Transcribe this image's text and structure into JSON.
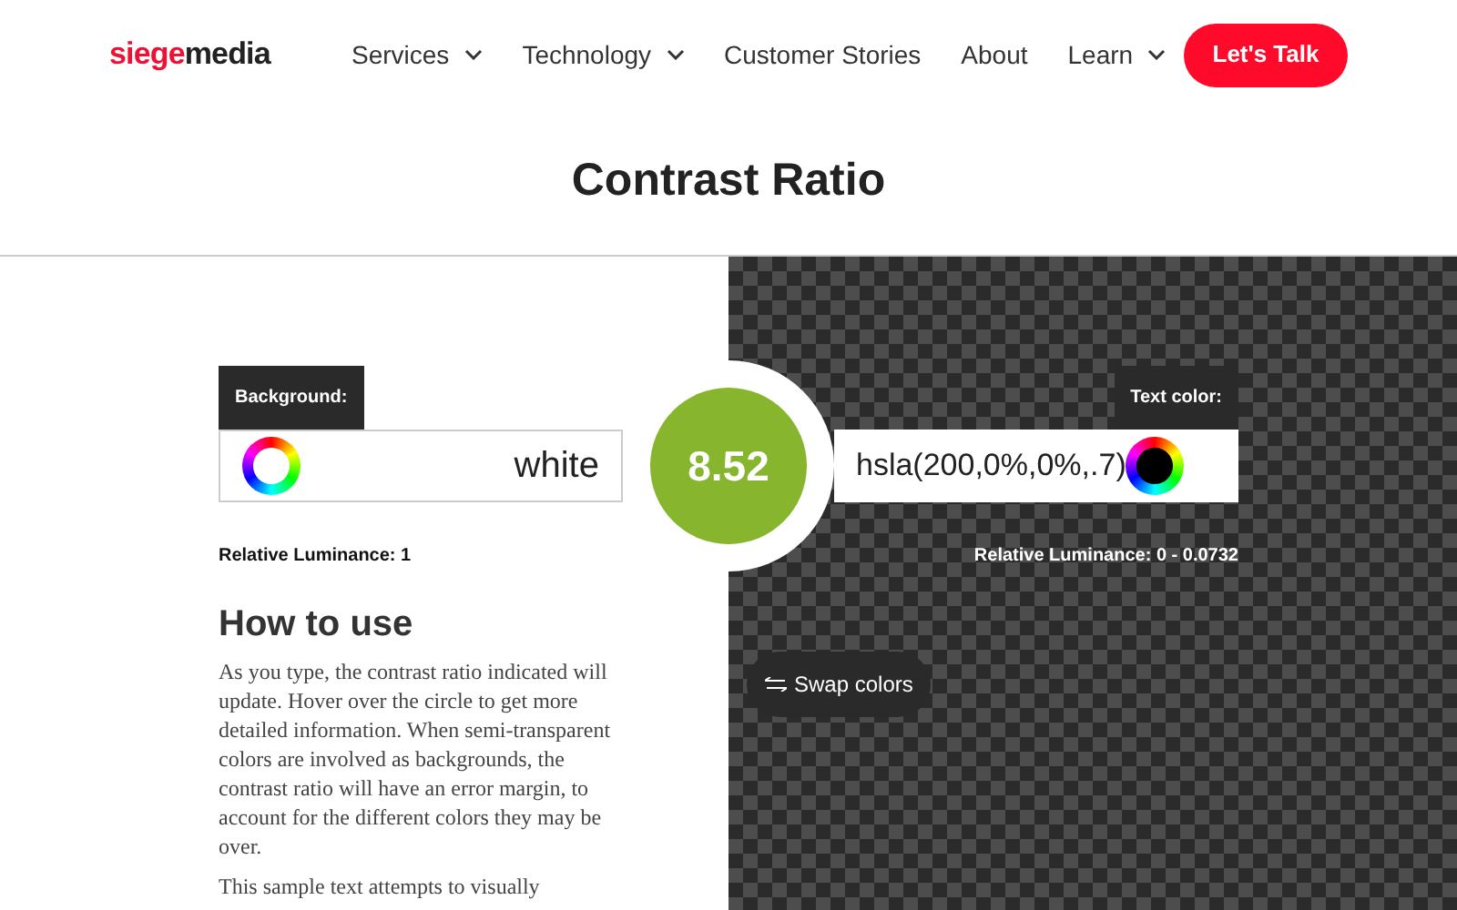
{
  "logo": {
    "part_1": "siege",
    "part_2": "media"
  },
  "nav": [
    {
      "label": "Services",
      "dropdown": true
    },
    {
      "label": "Technology",
      "dropdown": true
    },
    {
      "label": "Customer Stories",
      "dropdown": false
    },
    {
      "label": "About",
      "dropdown": false
    },
    {
      "label": "Learn",
      "dropdown": true
    }
  ],
  "cta": "Let's Talk",
  "title": "Contrast Ratio",
  "background": {
    "label": "Background:",
    "value": "white",
    "luminance": "Relative Luminance: 1"
  },
  "text_color": {
    "label": "Text color:",
    "value": "hsla(200,0%,0%,.7)",
    "luminance": "Relative Luminance: 0 - 0.0732"
  },
  "ratio": "8.52",
  "swap_button": "Swap colors",
  "how_to": {
    "heading": "How to use",
    "paragraphs": [
      "As you type, the contrast ratio indicated will update. Hover over the circle to get more detailed information. When semi-transparent colors are involved as backgrounds, the contrast ratio will have an error margin, to account for the different colors they may be over.",
      "This sample text attempts to visually"
    ]
  }
}
